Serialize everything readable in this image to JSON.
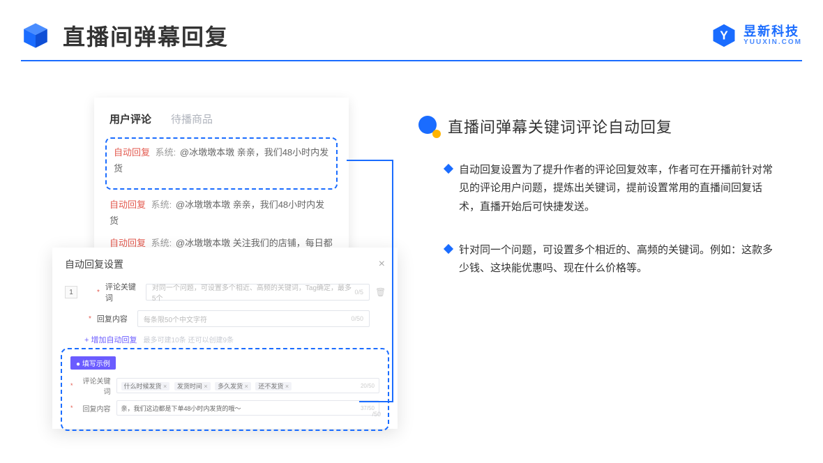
{
  "header": {
    "title": "直播间弹幕回复",
    "brand_cn": "昱新科技",
    "brand_en": "YUUXIN.COM"
  },
  "comments": {
    "tab_active": "用户评论",
    "tab_inactive": "待播商品",
    "highlighted": {
      "tag": "自动回复",
      "sys": "系统:",
      "text": "@冰墩墩本墩 亲亲，我们48小时内发货"
    },
    "lines": [
      {
        "tag": "自动回复",
        "sys": "系统:",
        "text": "@冰墩墩本墩 亲亲，我们48小时内发货"
      },
      {
        "tag": "自动回复",
        "sys": "系统:",
        "text": "@冰墩墩本墩 关注我们的店铺，每日都有热门推荐呦～"
      }
    ]
  },
  "settings": {
    "title": "自动回复设置",
    "index": "1",
    "keyword_label": "评论关键词",
    "keyword_placeholder": "对同一个问题，可设置多个相近、高频的关键词，Tag确定，最多5个",
    "keyword_count": "0/5",
    "content_label": "回复内容",
    "content_placeholder": "每条限50个中文字符",
    "content_count": "0/50",
    "add_link": "+ 增加自动回复",
    "add_hint": "最多可建10条 还可以创建9条",
    "example_pill": "● 填写示例",
    "ex_keyword_label": "评论关键词",
    "ex_tags": [
      "什么时候发货",
      "发货时间",
      "多久发货",
      "还不发货"
    ],
    "ex_keyword_count": "20/50",
    "ex_content_label": "回复内容",
    "ex_content_value": "亲，我们这边都是下单48小时内发货的哦～",
    "ex_content_count": "37/50",
    "lonely_count": "/50"
  },
  "right": {
    "section_title": "直播间弹幕关键词评论自动回复",
    "bullets": [
      "自动回复设置为了提升作者的评论回复效率，作者可在开播前针对常见的评论用户问题，提炼出关键词，提前设置常用的直播间回复话术，直播开始后可快捷发送。",
      "针对同一个问题，可设置多个相近的、高频的关键词。例如：这款多少钱、这块能优惠吗、现在什么价格等。"
    ]
  }
}
